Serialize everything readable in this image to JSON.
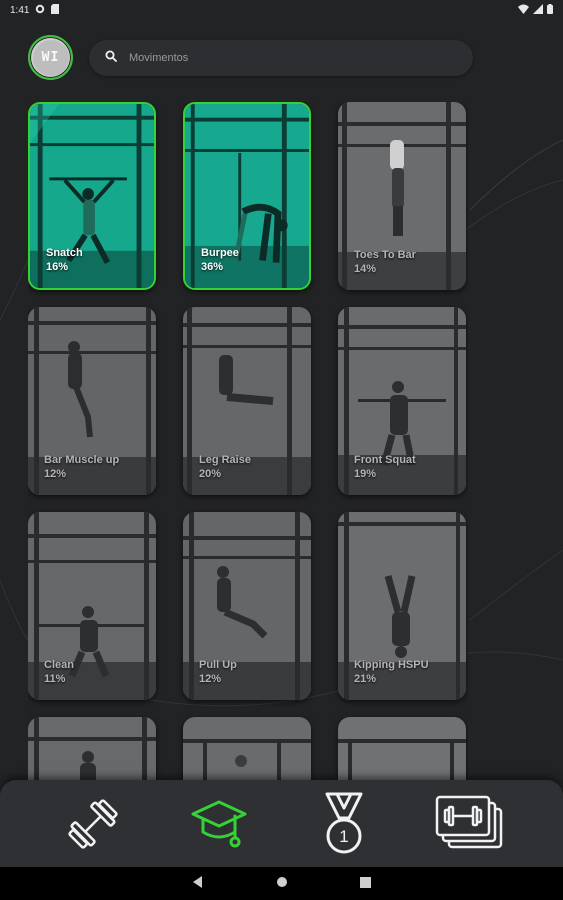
{
  "status_bar": {
    "time": "1:41"
  },
  "profile": {
    "initials": "WI"
  },
  "search": {
    "placeholder": "Movimentos"
  },
  "movements": [
    {
      "name": "Snatch",
      "percent": "16%",
      "active": true
    },
    {
      "name": "Burpee",
      "percent": "36%",
      "active": true
    },
    {
      "name": "Toes To Bar",
      "percent": "14%",
      "active": false
    },
    {
      "name": "Bar Muscle up",
      "percent": "12%",
      "active": false
    },
    {
      "name": "Leg Raise",
      "percent": "20%",
      "active": false
    },
    {
      "name": "Front Squat",
      "percent": "19%",
      "active": false
    },
    {
      "name": "Clean",
      "percent": "11%",
      "active": false
    },
    {
      "name": "Pull Up",
      "percent": "12%",
      "active": false
    },
    {
      "name": "Kipping HSPU",
      "percent": "21%",
      "active": false
    },
    {
      "name": "",
      "percent": "",
      "active": false
    },
    {
      "name": "",
      "percent": "",
      "active": false
    },
    {
      "name": "",
      "percent": "",
      "active": false
    }
  ],
  "bottom_nav": [
    {
      "icon": "dumbbell-icon",
      "selected": false
    },
    {
      "icon": "graduation-cap-icon",
      "selected": true
    },
    {
      "icon": "medal-icon",
      "selected": false
    },
    {
      "icon": "workout-cards-icon",
      "selected": false
    }
  ],
  "medal_number": "1",
  "colors": {
    "accent": "#35d235",
    "teal": "#1fb39a",
    "background": "#222325",
    "nav": "#2f3033"
  }
}
